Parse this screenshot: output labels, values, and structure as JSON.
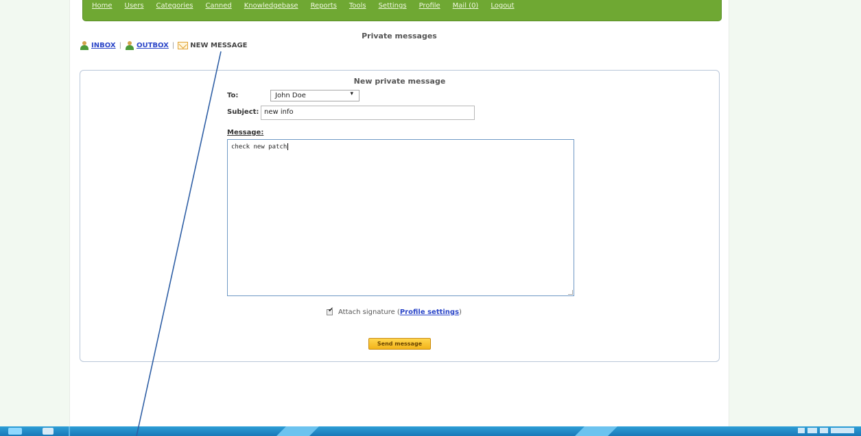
{
  "topnav": {
    "items": [
      "Home",
      "Users",
      "Categories",
      "Canned",
      "Knowledgebase",
      "Reports",
      "Tools",
      "Settings",
      "Profile",
      "Mail (0)",
      "Logout"
    ]
  },
  "page_title": "Private messages",
  "msgnav": {
    "inbox": "INBOX",
    "outbox": "OUTBOX",
    "new_message": "NEW MESSAGE",
    "separator": "|"
  },
  "form": {
    "title": "New private message",
    "to_label": "To:",
    "to_value": "John Doe",
    "subject_label": "Subject:",
    "subject_value": "new info",
    "message_label": "Message:",
    "message_value": "check new patch",
    "attach_signature_label": "Attach signature (",
    "profile_settings_link": "Profile settings",
    "attach_signature_close": ")",
    "attach_signature_checked": true,
    "send_button": "Send message"
  },
  "colors": {
    "nav_green": "#6fa833",
    "link_blue": "#2a45c8",
    "send_button_gold": "#f2b41a",
    "taskbar_blue": "#1a78b8",
    "annotation_line": "#2f5fa5"
  },
  "icons": {
    "inbox": "user-icon",
    "outbox": "user-icon",
    "new_message": "mail-icon"
  }
}
